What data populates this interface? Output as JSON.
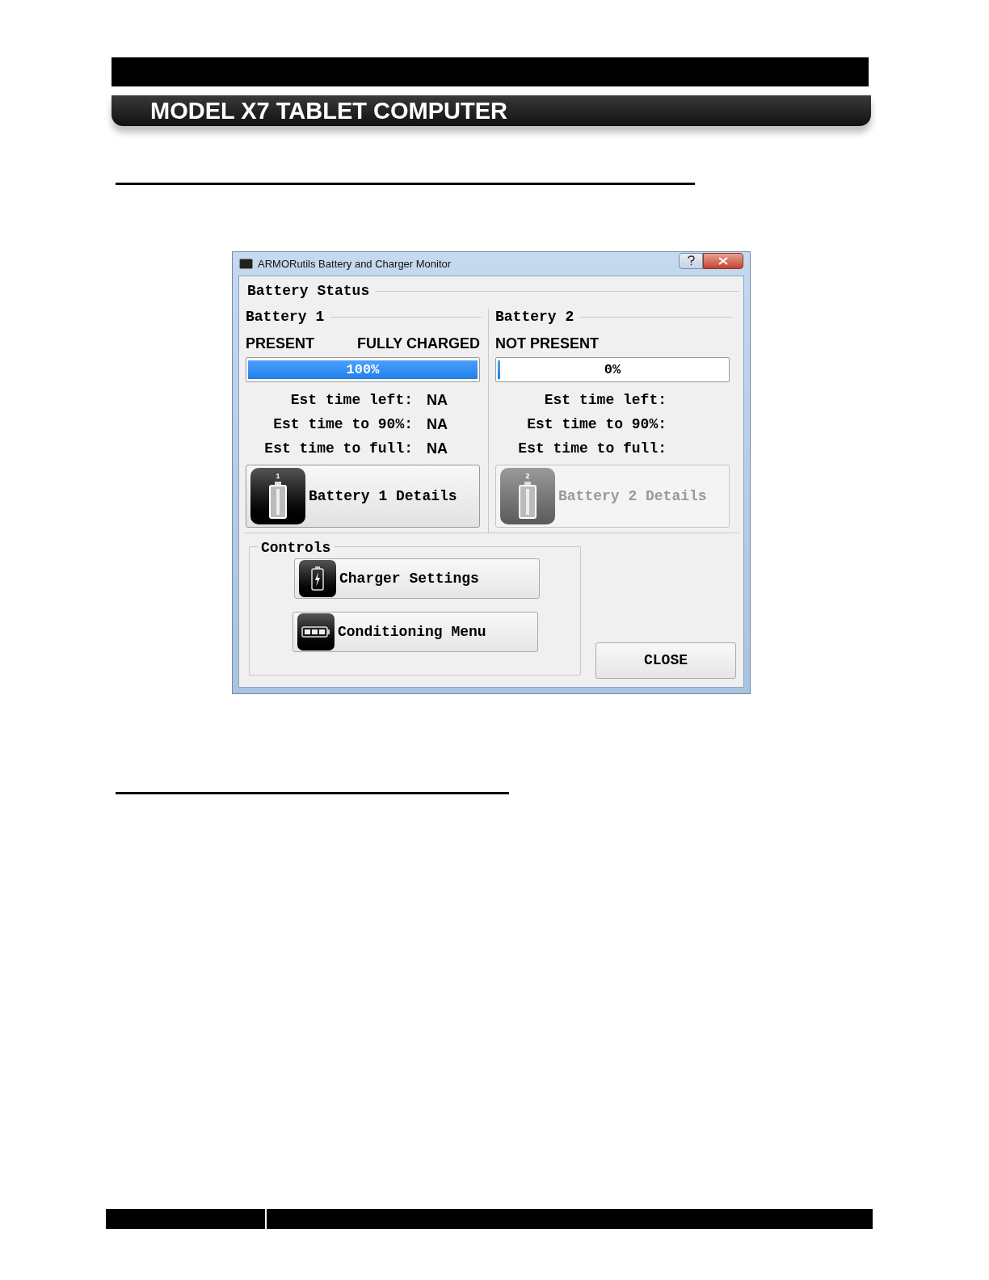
{
  "header": {
    "title": "MODEL X7 TABLET COMPUTER"
  },
  "dialog": {
    "title": "ARMORutils Battery and Charger Monitor",
    "battery_status": {
      "title": "Battery Status",
      "batteries": [
        {
          "title": "Battery 1",
          "presence": "PRESENT",
          "charge_state": "FULLY CHARGED",
          "level": 1,
          "reading": "100%",
          "rows": [
            {
              "label": "Est time left:",
              "value": "NA"
            },
            {
              "label": "Est time to 90%:",
              "value": "NA"
            },
            {
              "label": "Est time to full:",
              "value": "NA"
            }
          ],
          "icon_number": "1",
          "details_button": {
            "label": "Battery 1 Details",
            "disabled": false
          }
        },
        {
          "title": "Battery 2",
          "presence": "NOT PRESENT",
          "level": 0,
          "reading": "0%",
          "rows": [
            {
              "label": "Est time left:"
            },
            {
              "label": "Est time to 90%:"
            },
            {
              "label": "Est time to full:"
            }
          ],
          "icon_number": "2",
          "details_button": {
            "label": "Battery 2 Details",
            "disabled": true
          }
        }
      ]
    },
    "controls": {
      "title": "Controls",
      "buttons": [
        {
          "label": "Charger Settings",
          "kind": "charger"
        },
        {
          "label": "Conditioning Menu",
          "kind": "conditioning"
        }
      ]
    },
    "close_button": "CLOSE"
  }
}
